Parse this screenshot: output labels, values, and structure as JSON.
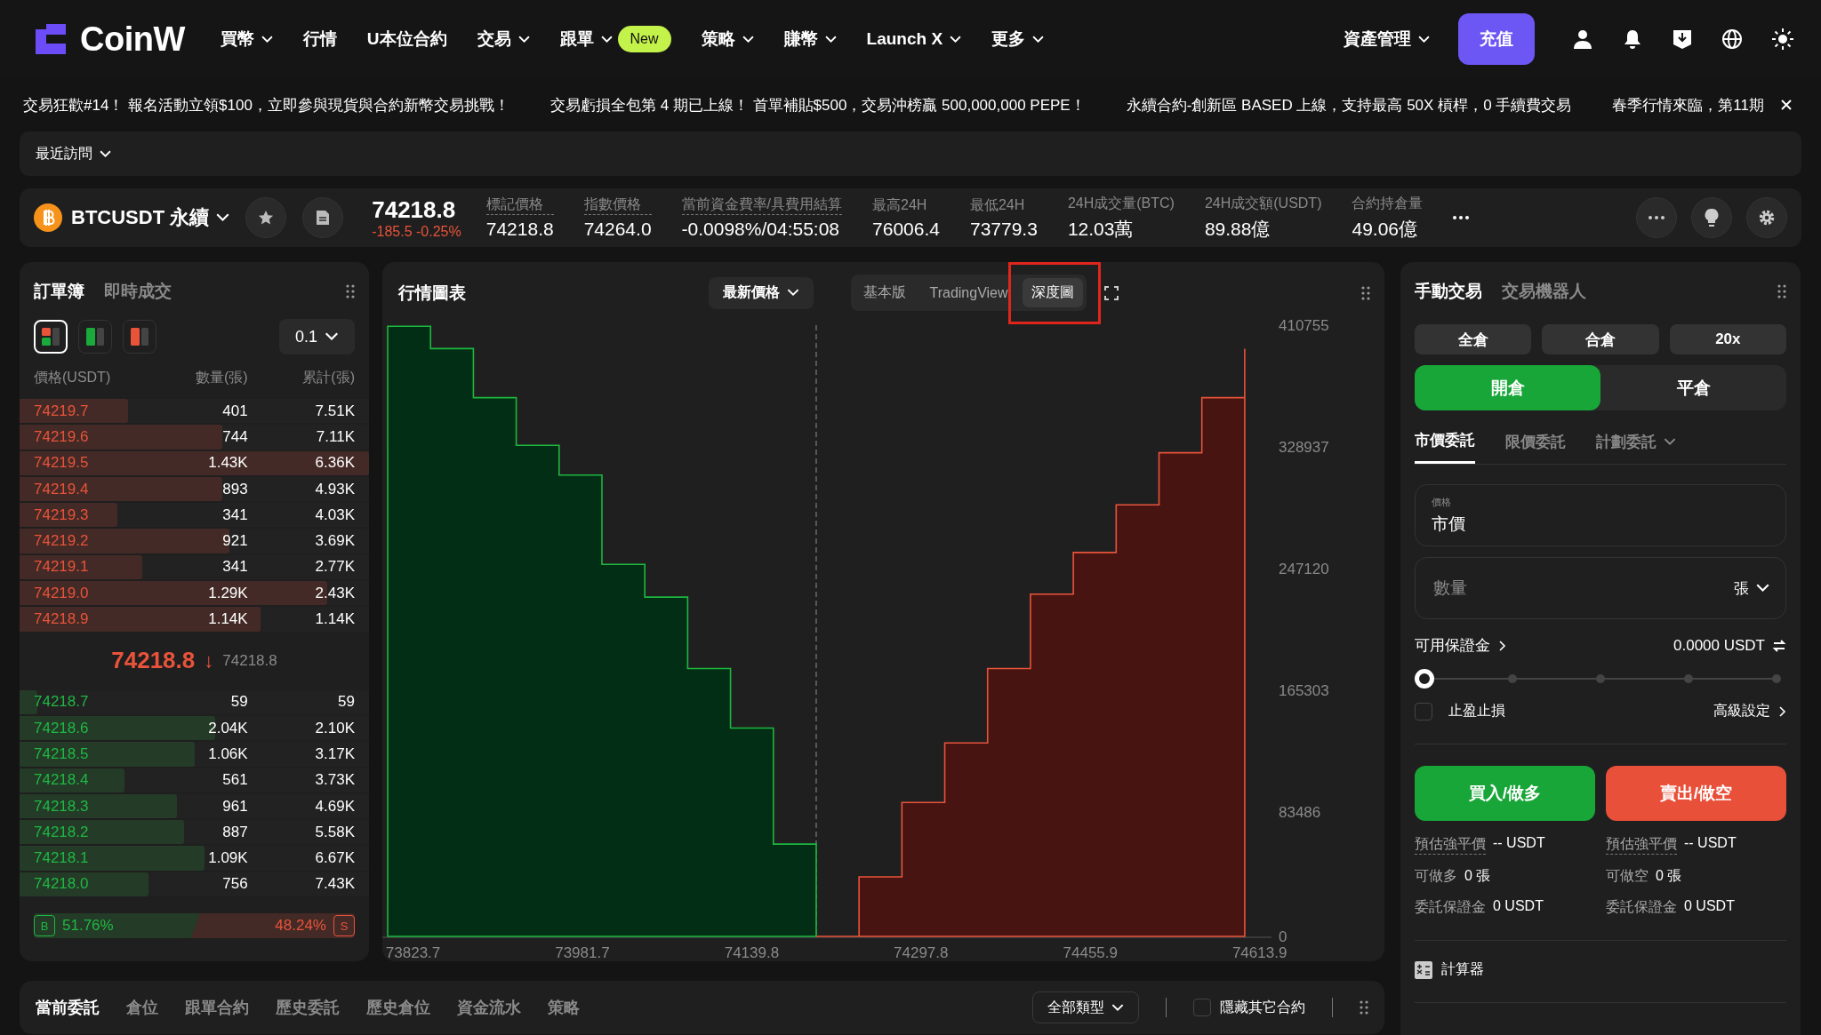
{
  "nav": {
    "logo": "CoinW",
    "items": [
      {
        "label": "買幣",
        "dropdown": true
      },
      {
        "label": "行情",
        "dropdown": false
      },
      {
        "label": "U本位合約",
        "dropdown": false
      },
      {
        "label": "交易",
        "dropdown": true
      },
      {
        "label": "跟單",
        "dropdown": true,
        "badge": "New"
      },
      {
        "label": "策略",
        "dropdown": true
      },
      {
        "label": "賺幣",
        "dropdown": true
      },
      {
        "label": "Launch X",
        "dropdown": true
      },
      {
        "label": "更多",
        "dropdown": true
      }
    ],
    "assets": "資產管理",
    "deposit": "充值"
  },
  "announcements": [
    "交易狂歡#14！ 報名活動立領$100，立即參與現貨與合約新幣交易挑戰！",
    "交易虧損全包第 4 期已上線！ 首單補貼$500，交易沖榜贏 500,000,000 PEPE！",
    "永續合約-創新區 BASED 上線，支持最高 50X 槓桿，0 手續費交易",
    "春季行情來臨，第11期"
  ],
  "recent": "最近訪問",
  "ticker": {
    "symbol": "BTCUSDT 永續",
    "price": "74218.8",
    "change": "-185.5 -0.25%",
    "stats": [
      {
        "label": "標記價格",
        "value": "74218.8",
        "dotted": true
      },
      {
        "label": "指數價格",
        "value": "74264.0",
        "dotted": true
      },
      {
        "label": "當前資金費率/具費用結算",
        "value": "-0.0098%/04:55:08",
        "dotted": true
      },
      {
        "label": "最高24H",
        "value": "76006.4",
        "dotted": false
      },
      {
        "label": "最低24H",
        "value": "73779.3",
        "dotted": false
      },
      {
        "label": "24H成交量(BTC)",
        "value": "12.03萬",
        "dotted": false
      },
      {
        "label": "24H成交額(USDT)",
        "value": "89.88億",
        "dotted": false
      },
      {
        "label": "合約持倉量",
        "value": "49.06億",
        "dotted": false
      }
    ]
  },
  "orderbook": {
    "tabs": [
      {
        "label": "訂單簿",
        "selected": true
      },
      {
        "label": "即時成交",
        "selected": false
      }
    ],
    "modes": [
      {
        "kind": "both",
        "selected": true
      },
      {
        "kind": "bids",
        "selected": false
      },
      {
        "kind": "asks",
        "selected": false
      }
    ],
    "precision": "0.1",
    "columns": [
      "價格(USDT)",
      "數量(張)",
      "累計(張)"
    ],
    "asks": [
      {
        "price": "74219.7",
        "qty": "401",
        "total": "7.51K",
        "level": 0.31
      },
      {
        "price": "74219.6",
        "qty": "744",
        "total": "7.11K",
        "level": 0.58
      },
      {
        "price": "74219.5",
        "qty": "1.43K",
        "total": "6.36K",
        "level": 1.0
      },
      {
        "price": "74219.4",
        "qty": "893",
        "total": "4.93K",
        "level": 0.58
      },
      {
        "price": "74219.3",
        "qty": "341",
        "total": "4.03K",
        "level": 0.28
      },
      {
        "price": "74219.2",
        "qty": "921",
        "total": "3.69K",
        "level": 0.6
      },
      {
        "price": "74219.1",
        "qty": "341",
        "total": "2.77K",
        "level": 0.35
      },
      {
        "price": "74219.0",
        "qty": "1.29K",
        "total": "2.43K",
        "level": 0.88
      },
      {
        "price": "74218.9",
        "qty": "1.14K",
        "total": "1.14K",
        "level": 0.69
      }
    ],
    "last_price": "74218.8",
    "arrow": "↓",
    "mark_price": "74218.8",
    "bids": [
      {
        "price": "74218.7",
        "qty": "59",
        "total": "59",
        "level": 0.05
      },
      {
        "price": "74218.6",
        "qty": "2.04K",
        "total": "2.10K",
        "level": 0.56
      },
      {
        "price": "74218.5",
        "qty": "1.06K",
        "total": "3.17K",
        "level": 0.5
      },
      {
        "price": "74218.4",
        "qty": "561",
        "total": "3.73K",
        "level": 0.3
      },
      {
        "price": "74218.3",
        "qty": "961",
        "total": "4.69K",
        "level": 0.45
      },
      {
        "price": "74218.2",
        "qty": "887",
        "total": "5.58K",
        "level": 0.47
      },
      {
        "price": "74218.1",
        "qty": "1.09K",
        "total": "6.67K",
        "level": 0.53
      },
      {
        "price": "74218.0",
        "qty": "756",
        "total": "7.43K",
        "level": 0.37
      }
    ],
    "ratio": {
      "buy_tag": "B",
      "buy": "51.76%",
      "sell_tag": "S",
      "sell": "48.24%",
      "level": 0.5176
    }
  },
  "chart_panel": {
    "title": "行情圖表",
    "price_type": "最新價格",
    "views": [
      {
        "label": "基本版",
        "selected": false
      },
      {
        "label": "TradingView",
        "selected": false
      },
      {
        "label": "深度圖",
        "selected": true
      }
    ],
    "chart_data": {
      "type": "area",
      "x": [
        73800,
        73840,
        73880,
        73920,
        73960,
        74000,
        74040,
        74080,
        74120,
        74160,
        74200,
        74240,
        74280,
        74320,
        74360,
        74400,
        74440,
        74480,
        74520,
        74560,
        74600
      ],
      "series": [
        {
          "color": "#1db83f",
          "values": [
            410000,
            395000,
            362000,
            330000,
            310000,
            250000,
            228000,
            180000,
            140000,
            62000,
            0,
            null,
            null,
            null,
            null,
            null,
            null,
            null,
            null,
            null,
            null
          ]
        },
        {
          "color": "#e8533a",
          "values": [
            null,
            null,
            null,
            null,
            null,
            null,
            null,
            null,
            null,
            null,
            0,
            40000,
            90000,
            130000,
            180000,
            230000,
            258000,
            290000,
            325000,
            362000,
            395000
          ]
        }
      ],
      "xlim": [
        73795,
        74625
      ],
      "ylim": [
        0,
        410755
      ],
      "ref_lines": [
        {
          "axis": "x",
          "value": 74200
        }
      ],
      "xticks": [
        73823.7,
        73981.7,
        74139.8,
        74297.8,
        74455.9,
        74613.9
      ],
      "yticks": [
        0,
        83486,
        165303,
        247120,
        328937,
        410755
      ]
    }
  },
  "trade": {
    "tabs": [
      {
        "label": "手動交易",
        "selected": true
      },
      {
        "label": "交易機器人",
        "selected": false
      }
    ],
    "margin_buttons": [
      "全倉",
      "合倉",
      "20x"
    ],
    "sides": [
      {
        "label": "開倉",
        "selected": true
      },
      {
        "label": "平倉",
        "selected": false
      }
    ],
    "order_types": [
      {
        "label": "市價委託",
        "selected": true,
        "dropdown": false
      },
      {
        "label": "限價委託",
        "selected": false,
        "dropdown": false
      },
      {
        "label": "計劃委託",
        "selected": false,
        "dropdown": true
      }
    ],
    "price_field": {
      "label": "價格",
      "value": "市價"
    },
    "qty_field": {
      "placeholder": "數量",
      "unit": "張"
    },
    "available": {
      "label": "可用保證金",
      "value": "0.0000 USDT"
    },
    "slider": {
      "level": 0
    },
    "tpsl": {
      "label": "止盈止損",
      "checked": false
    },
    "advanced": "高級設定",
    "buy": "買入/做多",
    "sell": "賣出/做空",
    "info": [
      [
        {
          "label": "預估強平價",
          "value": "-- USDT",
          "dotted": true
        },
        {
          "label": "可做多",
          "value": "0 張",
          "dotted": false
        },
        {
          "label": "委託保證金",
          "value": "0 USDT",
          "dotted": false
        }
      ],
      [
        {
          "label": "預估強平價",
          "value": "-- USDT",
          "dotted": true
        },
        {
          "label": "可做空",
          "value": "0 張",
          "dotted": false
        },
        {
          "label": "委託保證金",
          "value": "0 USDT",
          "dotted": false
        }
      ]
    ],
    "calculator": "計算器"
  },
  "orders": {
    "tabs": [
      {
        "label": "當前委託",
        "selected": true
      },
      {
        "label": "倉位",
        "selected": false
      },
      {
        "label": "跟單合約",
        "selected": false
      },
      {
        "label": "歷史委託",
        "selected": false
      },
      {
        "label": "歷史倉位",
        "selected": false
      },
      {
        "label": "資金流水",
        "selected": false
      },
      {
        "label": "策略",
        "selected": false
      }
    ],
    "filter": "全部類型",
    "hide_other": {
      "label": "隱藏其它合約",
      "checked": false
    }
  }
}
